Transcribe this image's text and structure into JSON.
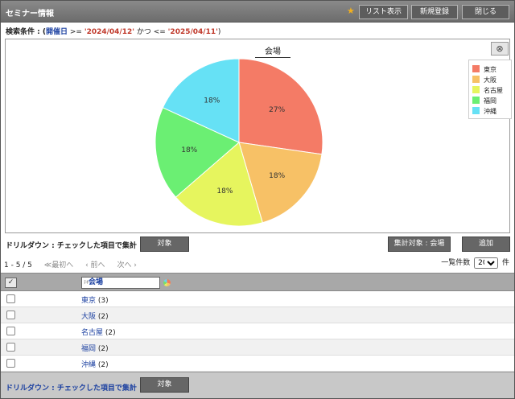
{
  "header": {
    "title": "セミナー情報",
    "buttons": {
      "list_view": "リスト表示",
      "new_entry": "新規登録",
      "close": "閉じる"
    }
  },
  "search_condition": {
    "prefix": "検索条件 : (",
    "field": "開催日",
    "op1": " >= ",
    "value1": "'2024/04/12'",
    "conj": " かつ <= ",
    "value2": "'2025/04/11'",
    "suffix": ")"
  },
  "chart": {
    "close_glyph": "⊗"
  },
  "chart_data": {
    "type": "pie",
    "title": "会場",
    "categories": [
      "東京",
      "大阪",
      "名古屋",
      "福岡",
      "沖縄"
    ],
    "values": [
      3,
      2,
      2,
      2,
      2
    ],
    "percent_labels": [
      "27%",
      "18%",
      "18%",
      "18%",
      "18%"
    ],
    "colors": [
      "#f47b66",
      "#f7c166",
      "#e6f55e",
      "#6bef73",
      "#66e1f5"
    ],
    "legend_position": "right"
  },
  "drilldown": {
    "label": "ドリルダウン : チェックした項目で集計",
    "target_button": "対象",
    "aggregate_target": "集計対象 : 会場",
    "add_button": "追加"
  },
  "pager": {
    "range": "1 - 5 / 5",
    "first": "≪最初へ",
    "prev": "‹ 前へ",
    "next": "次へ ›",
    "per_page_label": "一覧件数",
    "per_page_value": "20",
    "unit": "件"
  },
  "table": {
    "check_all_glyph": "✓",
    "filter_prefix": "ﾃｷ",
    "filter_label": "会場",
    "rows": [
      {
        "name": "東京",
        "count": "(3)"
      },
      {
        "name": "大阪",
        "count": "(2)"
      },
      {
        "name": "名古屋",
        "count": "(2)"
      },
      {
        "name": "福岡",
        "count": "(2)"
      },
      {
        "name": "沖縄",
        "count": "(2)"
      }
    ]
  },
  "footer": {
    "drill_label": "ドリルダウン : チェックした項目で集計",
    "target_button": "対象"
  }
}
